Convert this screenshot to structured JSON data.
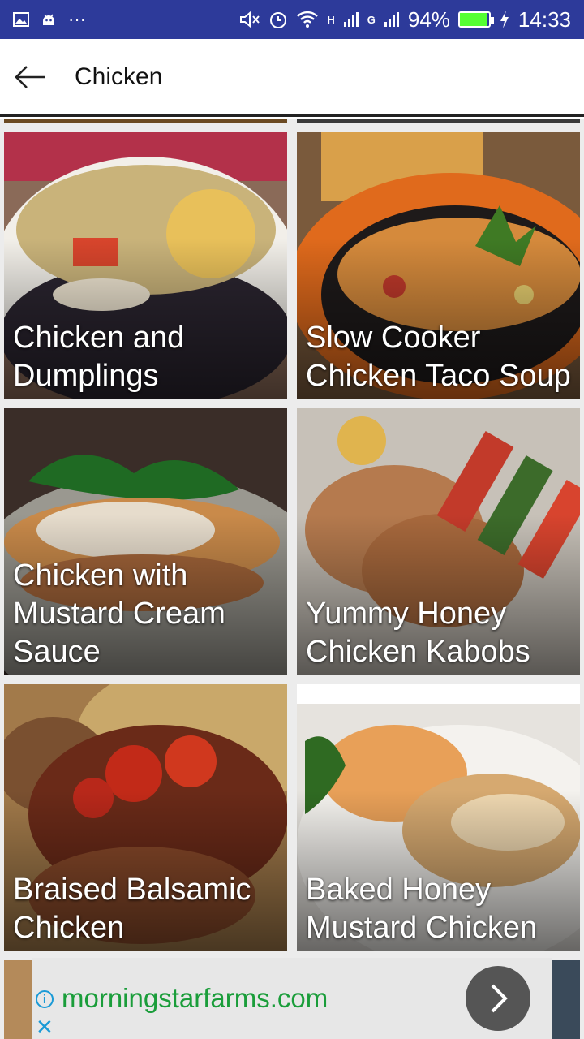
{
  "status_bar": {
    "signal_labels": [
      "H",
      "G"
    ],
    "battery": "94%",
    "time": "14:33",
    "icons": [
      "image-icon",
      "android-icon",
      "more-dots-icon",
      "mute-icon",
      "alarm-icon",
      "wifi-icon",
      "signal-icon",
      "battery-icon",
      "charging-icon"
    ]
  },
  "app_bar": {
    "title": "Chicken"
  },
  "recipes": [
    {
      "title": "Chicken and Dumplings"
    },
    {
      "title": "Slow Cooker Chicken Taco Soup"
    },
    {
      "title": "Chicken with Mustard Cream Sauce"
    },
    {
      "title": "Yummy Honey Chicken Kabobs"
    },
    {
      "title": "Braised Balsamic Chicken"
    },
    {
      "title": "Baked Honey Mustard Chicken"
    }
  ],
  "ad": {
    "url": "morningstarfarms.com",
    "info_glyph": "i",
    "close_glyph": "✕"
  },
  "colors": {
    "status_bar": "#2d3a9a",
    "ad_url": "#1a9d3a",
    "ad_icon": "#1a9ad6"
  }
}
